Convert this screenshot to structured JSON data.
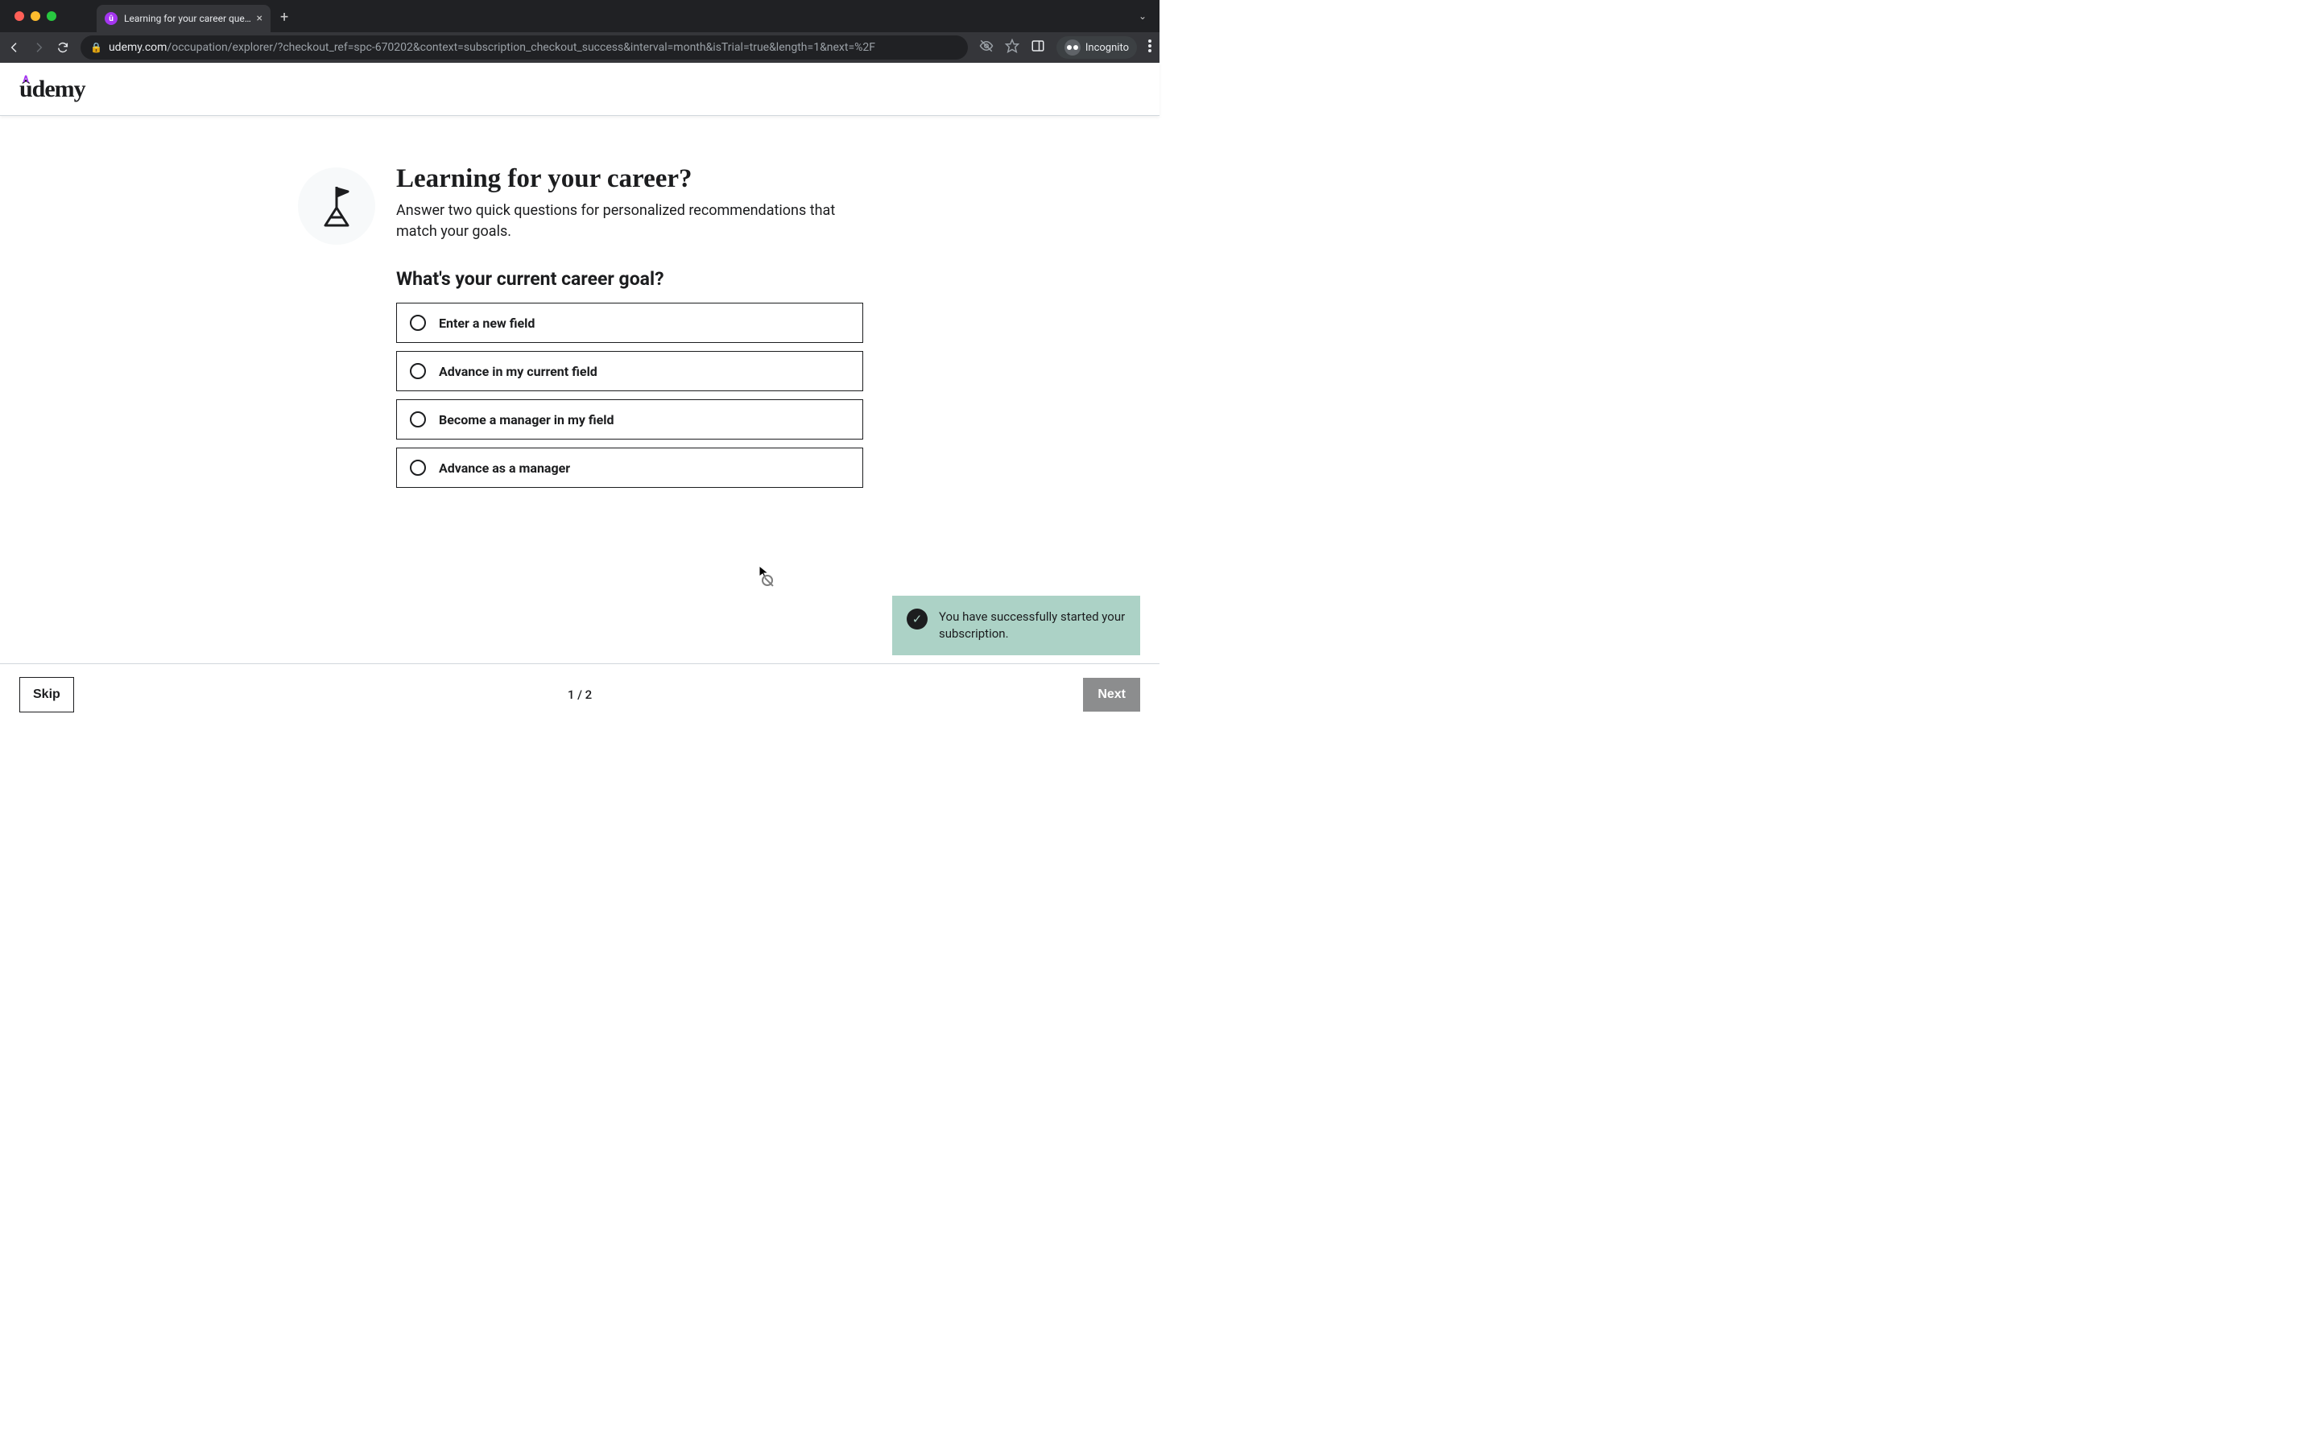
{
  "browser": {
    "tab_title": "Learning for your career quest",
    "new_tab": "+",
    "url_host": "udemy.com",
    "url_path": "/occupation/explorer/?checkout_ref=spc-670202&context=subscription_checkout_success&interval=month&isTrial=true&length=1&next=%2F",
    "incognito_label": "Incognito"
  },
  "page": {
    "logo_text": "ûdemy",
    "headline": "Learning for your career?",
    "subtext": "Answer two quick questions for personalized recommendations that match your goals.",
    "question": "What's your current career goal?",
    "options": [
      "Enter a new field",
      "Advance in my current field",
      "Become a manager in my field",
      "Advance as a manager"
    ]
  },
  "footer": {
    "skip": "Skip",
    "pager": "1 / 2",
    "next": "Next"
  },
  "toast": {
    "message": "You have successfully started your subscription."
  }
}
